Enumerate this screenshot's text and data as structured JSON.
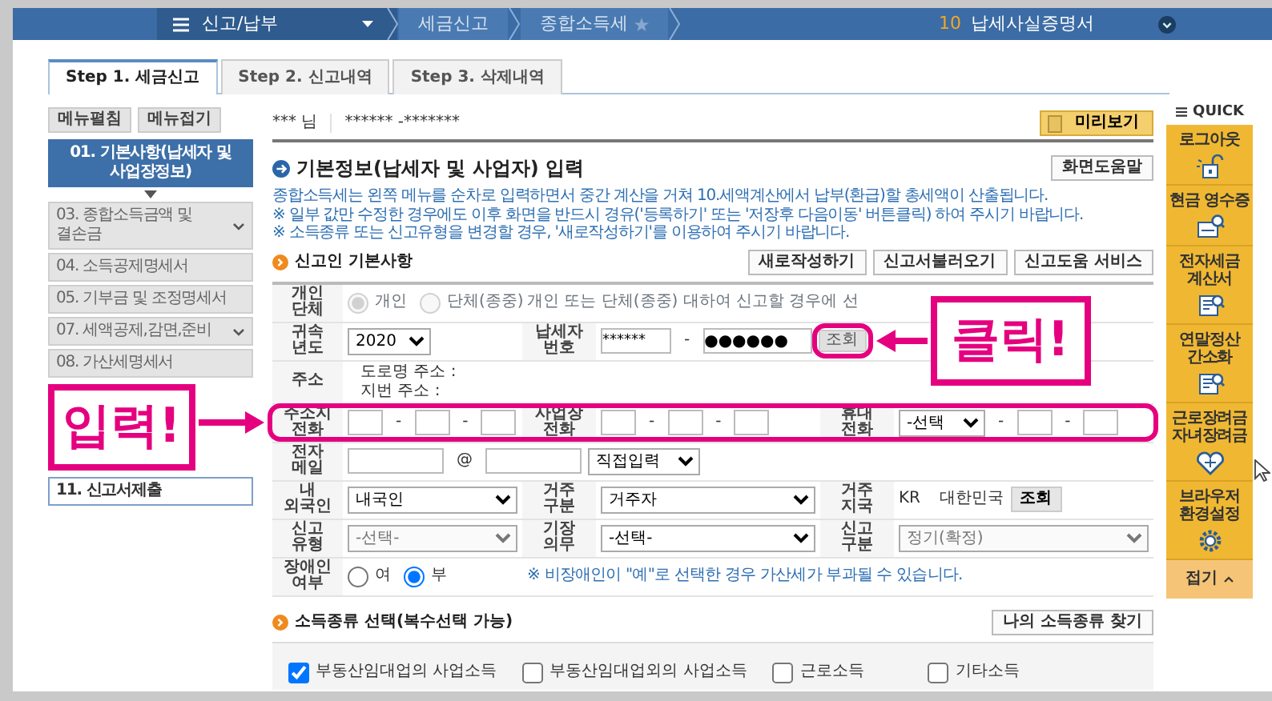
{
  "top_bar": {
    "menu_title": "신고/납부",
    "breadcrumbs": [
      {
        "label": "세금신고"
      },
      {
        "label": "종합소득세"
      }
    ],
    "current": {
      "number": "10",
      "label": "납세사실증명서"
    }
  },
  "tabs": [
    {
      "label": "Step 1. 세금신고",
      "selected": true
    },
    {
      "label": "Step 2. 신고내역",
      "selected": false
    },
    {
      "label": "Step 3. 삭제내역",
      "selected": false
    }
  ],
  "sidebar": {
    "buttons": [
      "메뉴펼침",
      "메뉴접기"
    ],
    "items": [
      {
        "kind": "step",
        "label": "01. 기본사항(납세자 및 사업장정보)",
        "selected": true,
        "expandable": false
      },
      {
        "kind": "step",
        "label": "03. 종합소득금액 및 결손금",
        "selected": false,
        "expandable": true
      },
      {
        "kind": "step",
        "label": "04. 소득공제명세서",
        "selected": false,
        "expandable": false
      },
      {
        "kind": "step",
        "label": "05. 기부금 및 조정명세서",
        "selected": false,
        "expandable": false
      },
      {
        "kind": "step",
        "label": "07. 세액공제,감면,준비",
        "selected": false,
        "expandable": true
      },
      {
        "kind": "step",
        "label": "08. 가산세명세서",
        "selected": false,
        "expandable": false
      },
      {
        "kind": "submit",
        "label": "11. 신고서제출",
        "selected": false,
        "expandable": false
      }
    ]
  },
  "account": {
    "name": "*** 님",
    "id": "****** -*******"
  },
  "preview_button": "미리보기",
  "basic_section": {
    "title": "기본정보(납세자 및 사업자) 입력",
    "help_button": "화면도움말",
    "notices": [
      "종합소득세는 왼쪽 메뉴를 순차로 입력하면서 중간 계산을 거쳐 10.세액계산에서 납부(환급)할 총세액이 산출됩니다.",
      "※ 일부 값만 수정한 경우에도 이후 화면을 반드시 경유('등록하기' 또는 '저장후 다음이동' 버튼클릭) 하여 주시기 바랍니다.",
      "※ 소득종류 또는 신고유형을 변경할 경우, '새로작성하기'를 이용하여 주시기 바랍니다."
    ]
  },
  "taxpayer": {
    "title": "신고인 기본사항",
    "buttons": [
      "새로작성하기",
      "신고서불러오기",
      "신고도움 서비스"
    ],
    "rows": [
      {
        "highlighted": false,
        "cells": [
          {
            "kind": "label",
            "text": "개인 단체"
          },
          {
            "kind": "radios",
            "disabled": true,
            "options": [
              {
                "label": "개인",
                "selected": true
              },
              {
                "label": "단체(종중)",
                "selected": false
              }
            ]
          },
          {
            "kind": "note",
            "colspan": 4,
            "text": "개인 또는 단체(종중) 대하여 신고할 경우에 선"
          }
        ]
      },
      {
        "highlighted": false,
        "cells": [
          {
            "kind": "label",
            "text": "귀속 년도"
          },
          {
            "kind": "select",
            "value": "2020",
            "disabled": false
          },
          {
            "kind": "label",
            "text": "납세자 번호"
          },
          {
            "kind": "masked",
            "colspan": 3,
            "first": "******",
            "separator": "-",
            "second": "●●●●●●",
            "button": {
              "label": "조회",
              "highlighted": true
            }
          }
        ]
      },
      {
        "highlighted": false,
        "cells": [
          {
            "kind": "label",
            "text": "주소"
          },
          {
            "kind": "address",
            "colspan": 5,
            "lines": [
              "도로명 주소 :",
              "지번 주소 :"
            ]
          }
        ]
      },
      {
        "highlighted": true,
        "cells": [
          {
            "kind": "label",
            "text": "주소지 전화"
          },
          {
            "kind": "phone",
            "separator": "-"
          },
          {
            "kind": "label",
            "text": "사업장 전화"
          },
          {
            "kind": "phone",
            "separator": "-"
          },
          {
            "kind": "label",
            "text": "휴대 전화"
          },
          {
            "kind": "phone",
            "separator": "-",
            "carrier": "-선택"
          }
        ]
      },
      {
        "highlighted": false,
        "cells": [
          {
            "kind": "label",
            "text": "전자 메일"
          },
          {
            "kind": "email",
            "colspan": 5,
            "separator": "@",
            "domain": "직접입력"
          }
        ]
      },
      {
        "highlighted": false,
        "cells": [
          {
            "kind": "label",
            "text": "내 외국인"
          },
          {
            "kind": "select",
            "value": "내국인",
            "disabled": false
          },
          {
            "kind": "label",
            "text": "거주 구분"
          },
          {
            "kind": "select",
            "value": "거주자",
            "disabled": false
          },
          {
            "kind": "label",
            "text": "거주 지국"
          },
          {
            "kind": "country",
            "code": "KR",
            "name": "대한민국",
            "button": "조회"
          }
        ]
      },
      {
        "highlighted": false,
        "cells": [
          {
            "kind": "label",
            "text": "신고 유형"
          },
          {
            "kind": "select",
            "value": "-선택-",
            "disabled": true
          },
          {
            "kind": "label",
            "text": "기장 의무"
          },
          {
            "kind": "select",
            "value": "-선택-",
            "disabled": false
          },
          {
            "kind": "label",
            "text": "신고 구분"
          },
          {
            "kind": "select",
            "value": "정기(확정)",
            "disabled": true
          }
        ]
      },
      {
        "highlighted": false,
        "cells": [
          {
            "kind": "label",
            "text": "장애인 여부"
          },
          {
            "kind": "radios",
            "disabled": false,
            "options": [
              {
                "label": "여",
                "selected": false
              },
              {
                "label": "부",
                "selected": true
              }
            ]
          },
          {
            "kind": "warning",
            "colspan": 4,
            "text": "※ 비장애인이 \"예\"로 선택한 경우 가산세가 부과될 수 있습니다."
          }
        ]
      }
    ]
  },
  "income_types": {
    "title": "소득종류 선택(복수선택 가능)",
    "button": "나의 소득종류 찾기",
    "options": [
      {
        "label": "부동산임대업의 사업소득",
        "checked": true
      },
      {
        "label": "부동산임대업외의 사업소득",
        "checked": false
      },
      {
        "label": "근로소득",
        "checked": false
      },
      {
        "label": "기타소득",
        "checked": false
      }
    ]
  },
  "quick": {
    "title": "QUICK",
    "items": [
      {
        "label": "로그아웃"
      },
      {
        "label": "현금 영수증"
      },
      {
        "label": "전자세금 계산서"
      },
      {
        "label": "연말정산 간소화"
      },
      {
        "label": "근로장려금 자녀장려금"
      },
      {
        "label": "브라우저 환경설정"
      }
    ],
    "fold_button": "접기"
  },
  "annotations": [
    {
      "kind": "input",
      "text": "입력!"
    },
    {
      "kind": "click",
      "text": "클릭!"
    }
  ]
}
